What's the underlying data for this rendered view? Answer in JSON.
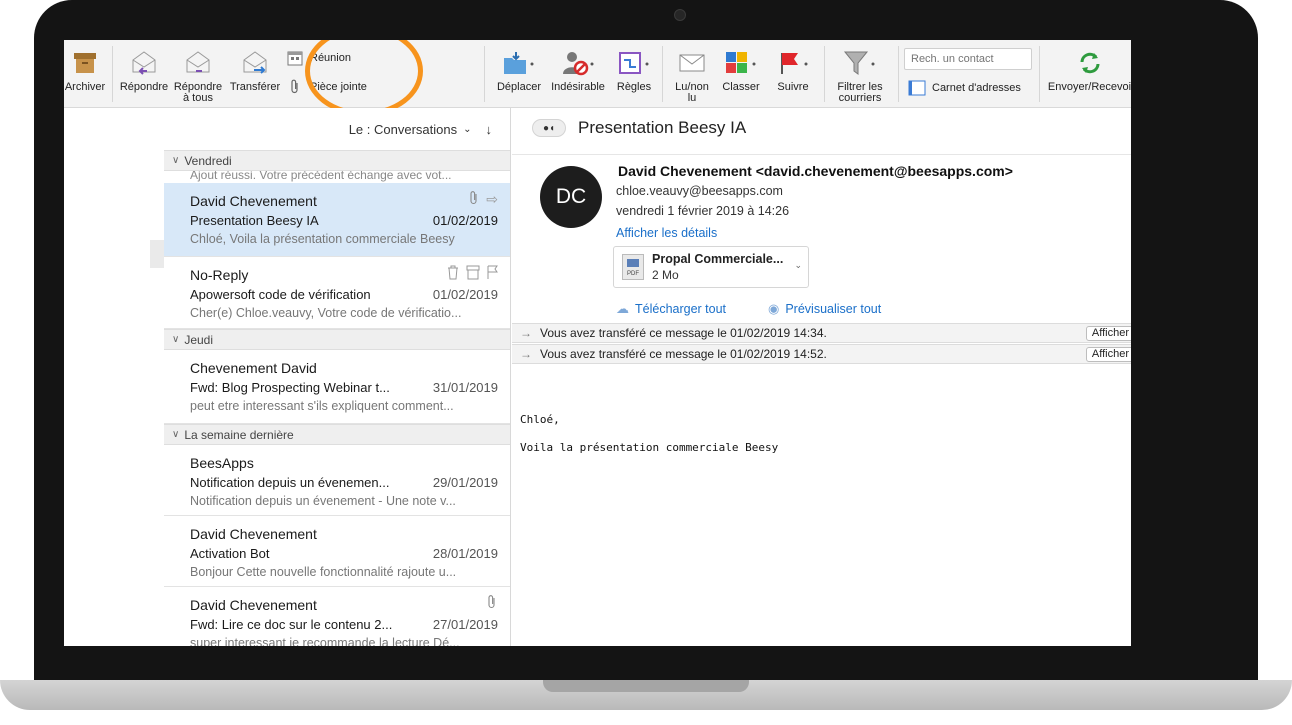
{
  "ribbon": {
    "archive": "Archiver",
    "reply": "Répondre",
    "reply_all": "Répondre\nà tous",
    "forward": "Transférer",
    "meeting": "Réunion",
    "attachment": "Pièce jointe",
    "move": "Déplacer",
    "junk": "Indésirable",
    "rules": "Règles",
    "read_unread": "Lu/non\nlu",
    "categorize": "Classer",
    "follow_up": "Suivre",
    "filter": "Filtrer les\ncourriers",
    "contact_search_placeholder": "Rech. un contact",
    "address_book": "Carnet d'adresses",
    "send_receive": "Envoyer/Recevoi"
  },
  "message_list": {
    "sort_label": "Le : Conversations",
    "groups": [
      {
        "label": "Vendredi",
        "clipped_preview": "Ajout réussi. Votre précédent échange avec vot...",
        "items": [
          {
            "sender": "David Chevenement",
            "subject": "Presentation Beesy IA",
            "date": "01/02/2019",
            "preview": "Chloé, Voila la présentation commerciale Beesy"
          },
          {
            "sender": "No-Reply",
            "subject": "Apowersoft code de vérification",
            "date": "01/02/2019",
            "preview": "Cher(e) Chloe.veauvy, Votre code de vérificatio..."
          }
        ]
      },
      {
        "label": "Jeudi",
        "items": [
          {
            "sender": "Chevenement David",
            "subject": "Fwd: Blog Prospecting Webinar t...",
            "date": "31/01/2019",
            "preview": "peut etre interessant s'ils expliquent comment..."
          }
        ]
      },
      {
        "label": "La semaine dernière",
        "items": [
          {
            "sender": "BeesApps",
            "subject": "Notification depuis un évenemen...",
            "date": "29/01/2019",
            "preview": "Notification depuis un évenement - Une note v..."
          },
          {
            "sender": "David Chevenement",
            "subject": "Activation Bot",
            "date": "28/01/2019",
            "preview": "Bonjour Cette nouvelle fonctionnalité rajoute u..."
          },
          {
            "sender": "David Chevenement",
            "subject": "Fwd: Lire ce doc sur le contenu 2...",
            "date": "27/01/2019",
            "preview": "super interessant je recommande la lecture Dé..."
          }
        ]
      }
    ]
  },
  "reading": {
    "subject": "Presentation Beesy IA",
    "avatar_initials": "DC",
    "from": "David Chevenement <david.chevenement@beesapps.com>",
    "to": "chloe.veauvy@beesapps.com",
    "date": "vendredi 1 février 2019 à 14:26",
    "details_link": "Afficher les détails",
    "attachment_name": "Propal Commerciale...",
    "attachment_size": "2 Mo",
    "download_all": "Télécharger tout",
    "preview_all": "Prévisualiser tout",
    "notice_1": "Vous avez transféré ce message le 01/02/2019 14:34.",
    "notice_2": "Vous avez transféré ce message le 01/02/2019 14:52.",
    "notice_button": "Afficher",
    "body_line_1": "Chloé,",
    "body_line_2": "Voila la présentation commerciale Beesy"
  },
  "colors": {
    "highlight": "#f7941d",
    "selected_row": "#d8e8f8",
    "link": "#1a6fc9"
  }
}
